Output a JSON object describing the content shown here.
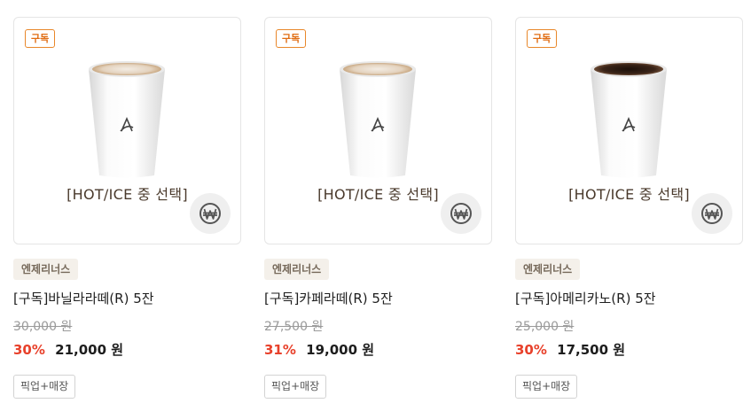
{
  "products": [
    {
      "badge": "구독",
      "image_caption": "[HOT/ICE 중 선택]",
      "brand": "엔제리너스",
      "name": "[구독]바닐라라떼(R) 5잔",
      "original_price": "30,000 원",
      "discount": "30%",
      "price": "21,000 원",
      "pickup": "픽업+매장",
      "drink": "latte"
    },
    {
      "badge": "구독",
      "image_caption": "[HOT/ICE 중 선택]",
      "brand": "엔제리너스",
      "name": "[구독]카페라떼(R) 5잔",
      "original_price": "27,500 원",
      "discount": "31%",
      "price": "19,000 원",
      "pickup": "픽업+매장",
      "drink": "latte"
    },
    {
      "badge": "구독",
      "image_caption": "[HOT/ICE 중 선택]",
      "brand": "엔제리너스",
      "name": "[구독]아메리카노(R) 5잔",
      "original_price": "25,000 원",
      "discount": "30%",
      "price": "17,500 원",
      "pickup": "픽업+매장",
      "drink": "americano"
    }
  ],
  "icons": {
    "price_button": "won-coin-icon",
    "cup_logo": "angelinus-logo-icon"
  },
  "colors": {
    "subscription_badge": "#e06c12",
    "discount": "#e8412b",
    "brand_tag_bg": "#f4f0ea",
    "latte_foam": "#c9a882",
    "americano": "#3a2418"
  }
}
